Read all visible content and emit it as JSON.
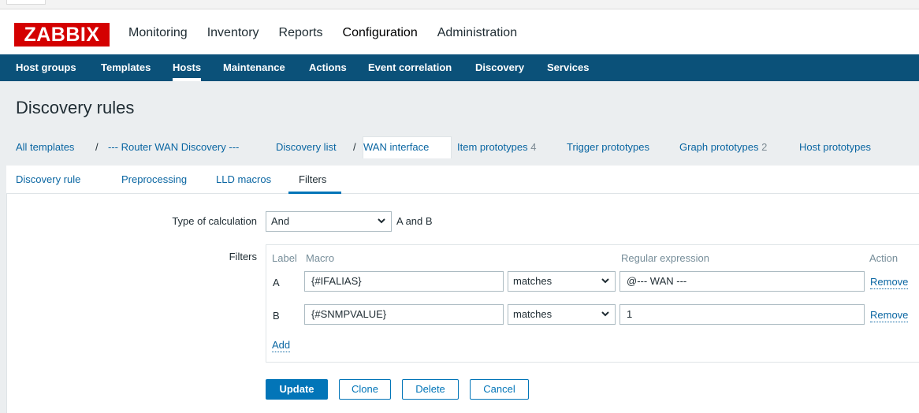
{
  "brand": {
    "logo_text": "ZABBIX",
    "logo_color": "#d40000"
  },
  "main_nav": [
    "Monitoring",
    "Inventory",
    "Reports",
    "Configuration",
    "Administration"
  ],
  "main_nav_active": "Configuration",
  "sub_nav": [
    "Host groups",
    "Templates",
    "Hosts",
    "Maintenance",
    "Actions",
    "Event correlation",
    "Discovery",
    "Services"
  ],
  "sub_nav_active": "Hosts",
  "page_title": "Discovery rules",
  "breadcrumbs": {
    "all_templates": "All templates",
    "sep": "/",
    "template": "--- Router WAN Discovery ---",
    "discovery_list": "Discovery list",
    "current": "WAN interface",
    "item_prototypes": "Item prototypes",
    "item_prototypes_count": "4",
    "trigger_prototypes": "Trigger prototypes",
    "graph_prototypes": "Graph prototypes",
    "graph_prototypes_count": "2",
    "host_prototypes": "Host prototypes"
  },
  "tabs": [
    "Discovery rule",
    "Preprocessing",
    "LLD macros",
    "Filters"
  ],
  "active_tab": "Filters",
  "form": {
    "type_of_calculation_label": "Type of calculation",
    "type_of_calculation_value": "And",
    "calculation_formula": "A and B",
    "filters_label": "Filters",
    "columns": {
      "label": "Label",
      "macro": "Macro",
      "regex": "Regular expression",
      "action": "Action"
    },
    "rows": [
      {
        "label": "A",
        "macro": "{#IFALIAS}",
        "operator": "matches",
        "value": "@--- WAN ---",
        "action": "Remove"
      },
      {
        "label": "B",
        "macro": "{#SNMPVALUE}",
        "operator": "matches",
        "value": "1",
        "action": "Remove"
      }
    ],
    "add_label": "Add"
  },
  "buttons": {
    "update": "Update",
    "clone": "Clone",
    "delete": "Delete",
    "cancel": "Cancel"
  },
  "colors": {
    "subnav_bg": "#0b5179",
    "link": "#0a66a2",
    "primary": "#0275b8",
    "page_bg": "#ebeef0"
  }
}
